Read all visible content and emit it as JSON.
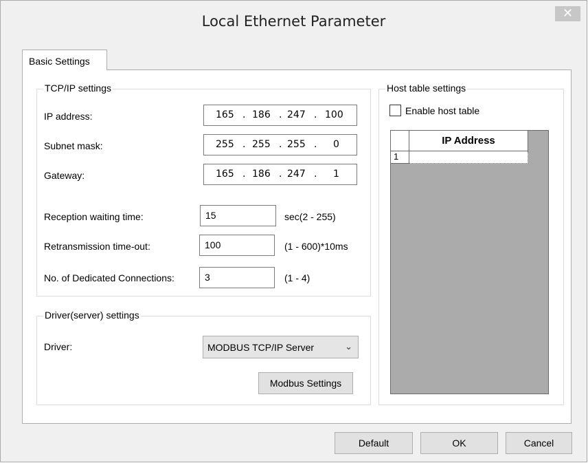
{
  "window": {
    "title": "Local Ethernet Parameter",
    "close_glyph": "✕"
  },
  "tabs": [
    {
      "label": "Basic Settings"
    }
  ],
  "tcpip": {
    "legend": "TCP/IP settings",
    "ip_label": "IP address:",
    "ip": [
      "165",
      "186",
      "247",
      "100"
    ],
    "subnet_label": "Subnet mask:",
    "subnet": [
      "255",
      "255",
      "255",
      "0"
    ],
    "gateway_label": "Gateway:",
    "gateway": [
      "165",
      "186",
      "247",
      "1"
    ],
    "dot": ".",
    "reception_label": "Reception waiting time:",
    "reception_value": "15",
    "reception_unit": "sec(2 - 255)",
    "retrans_label": "Retransmission time-out:",
    "retrans_value": "100",
    "retrans_unit": "(1 - 600)*10ms",
    "dedicated_label": "No. of Dedicated Connections:",
    "dedicated_value": "3",
    "dedicated_unit": "(1 - 4)"
  },
  "driver": {
    "legend": "Driver(server) settings",
    "driver_label": "Driver:",
    "driver_value": "MODBUS TCP/IP Server",
    "modbus_button": "Modbus Settings"
  },
  "host": {
    "legend": "Host table settings",
    "enable_label": "Enable host table",
    "enable_checked": false,
    "column_header": "IP Address",
    "rows": [
      {
        "index": "1",
        "ip": ""
      }
    ]
  },
  "footer": {
    "default_label": "Default",
    "ok_label": "OK",
    "cancel_label": "Cancel"
  },
  "colors": {
    "dialog_bg": "#f0f0f0",
    "panel_bg": "#ffffff",
    "grid_bg": "#ababab",
    "button_bg": "#e1e1e1"
  }
}
